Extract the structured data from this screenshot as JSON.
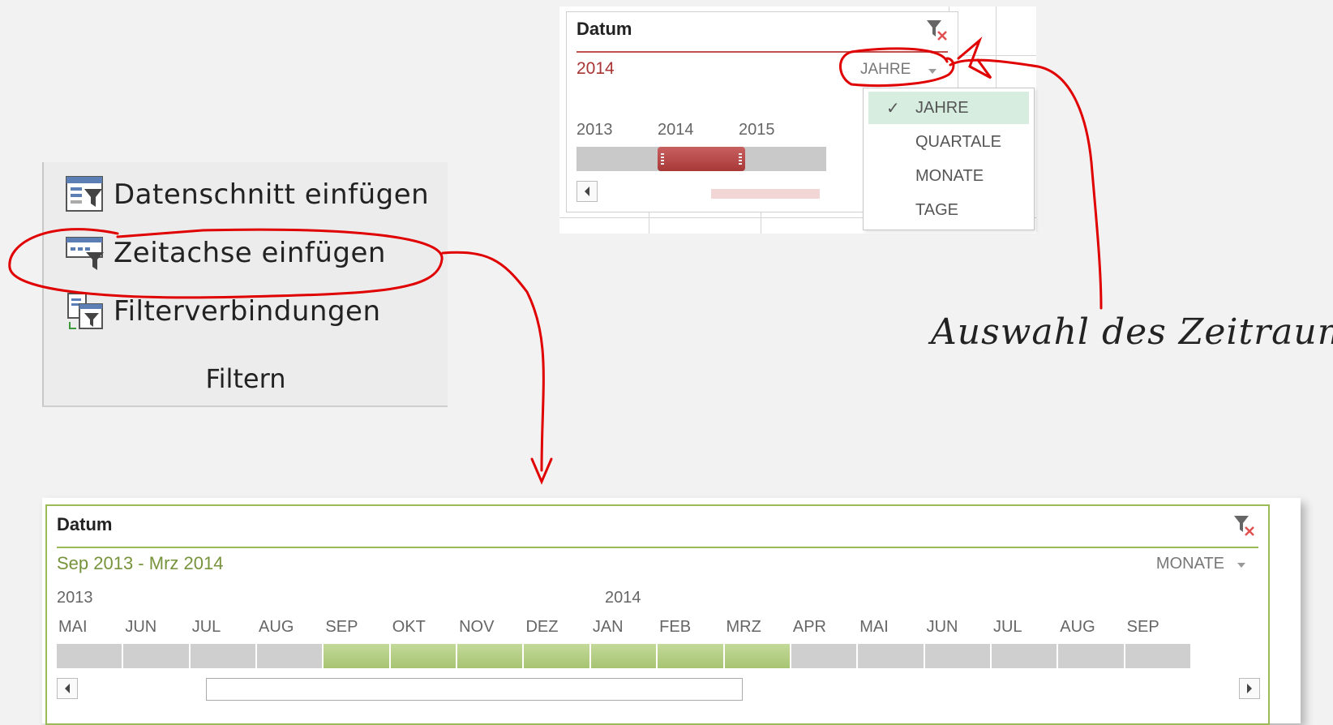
{
  "ribbon": {
    "items": [
      {
        "label": "Datenschnitt einfügen",
        "icon": "slicer-icon"
      },
      {
        "label": "Zeitachse einfügen",
        "icon": "timeline-icon"
      },
      {
        "label": "Filterverbindungen",
        "icon": "filter-connections-icon"
      }
    ],
    "group_label": "Filtern"
  },
  "small_timeline": {
    "title": "Datum",
    "range_label": "2014",
    "level": "JAHRE",
    "years": [
      "2013",
      "2014",
      "2015"
    ],
    "selected_year": "2014",
    "accent": "#c0504d"
  },
  "level_menu": {
    "items": [
      "JAHRE",
      "QUARTALE",
      "MONATE",
      "TAGE"
    ],
    "selected": "JAHRE"
  },
  "big_timeline": {
    "title": "Datum",
    "range_label": "Sep 2013 - Mrz 2014",
    "level": "MONATE",
    "years": [
      "2013",
      "2014"
    ],
    "months": [
      "MAI",
      "JUN",
      "JUL",
      "AUG",
      "SEP",
      "OKT",
      "NOV",
      "DEZ",
      "JAN",
      "FEB",
      "MRZ",
      "APR",
      "MAI",
      "JUN",
      "JUL",
      "AUG",
      "SEP"
    ],
    "selected_months": [
      "SEP",
      "OKT",
      "NOV",
      "DEZ",
      "JAN",
      "FEB",
      "MRZ"
    ],
    "accent": "#9bbb59"
  },
  "annotation": {
    "text": "Auswahl des Zeitraum",
    "color": "#e00000"
  }
}
